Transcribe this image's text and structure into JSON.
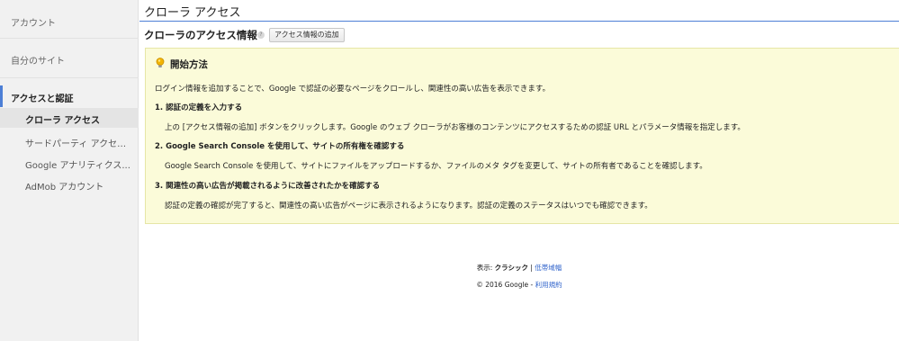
{
  "sidebar": {
    "account": "アカウント",
    "my_site": "自分のサイト",
    "group_title": "アクセスと認証",
    "items": [
      {
        "label": "クローラ アクセス"
      },
      {
        "label": "サードパーティ アクセス..."
      },
      {
        "label": "Google アナリティクス..."
      },
      {
        "label": "AdMob アカウント"
      }
    ]
  },
  "header": {
    "title": "クローラ アクセス"
  },
  "section": {
    "heading": "クローラのアクセス情報",
    "help": "?",
    "add_button": "アクセス情報の追加"
  },
  "info": {
    "title": "開始方法",
    "intro": "ログイン情報を追加することで、Google で認証の必要なページをクロールし、関連性の高い広告を表示できます。",
    "steps": [
      {
        "heading": "1. 認証の定義を入力する",
        "body": "上の [アクセス情報の追加] ボタンをクリックします。Google のウェブ クローラがお客様のコンテンツにアクセスするための認証 URL とパラメータ情報を指定します。"
      },
      {
        "heading": "2. Google Search Console を使用して、サイトの所有権を確認する",
        "body": "Google Search Console を使用して、サイトにファイルをアップロードするか、ファイルのメタ タグを変更して、サイトの所有者であることを確認します。"
      },
      {
        "heading": "3. 関連性の高い広告が掲載されるように改善されたかを確認する",
        "body": "認証の定義の確認が完了すると、関連性の高い広告がページに表示されるようになります。認証の定義のステータスはいつでも確認できます。"
      }
    ],
    "icon": "lightbulb-icon",
    "colors": {
      "background": "#fbfbd9",
      "accent": "#f2b400"
    }
  },
  "footer": {
    "display_label": "表示:",
    "classic": "クラシック",
    "separator": "|",
    "bandwidth": "低帯域幅",
    "copyright": "© 2016 Google -",
    "terms": "利用規約"
  },
  "colors": {
    "accent": "#4d7fd6",
    "link": "#3366cc",
    "sidebar_bg": "#f1f1f1"
  }
}
